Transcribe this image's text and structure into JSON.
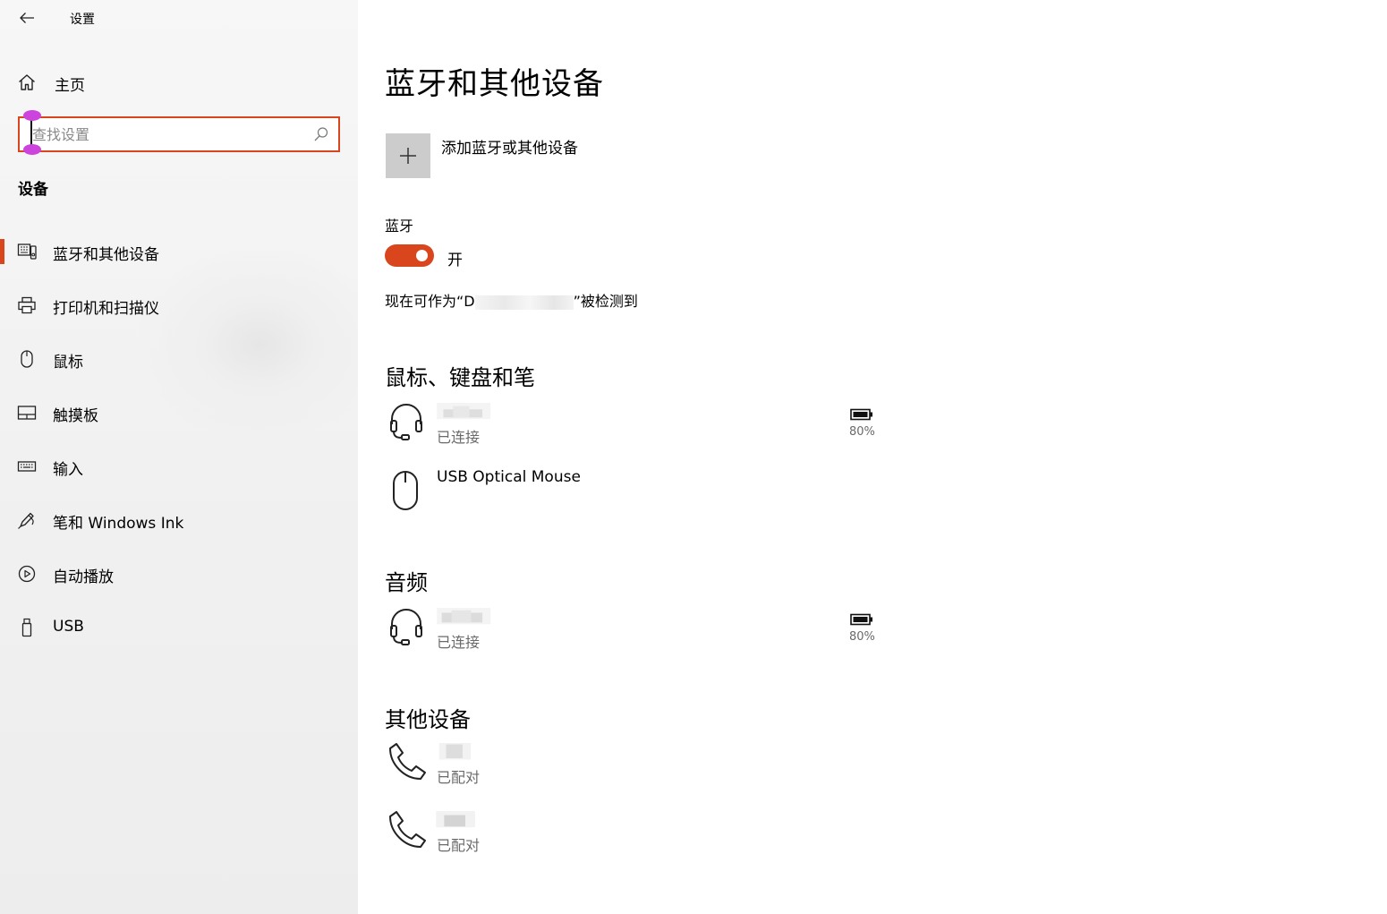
{
  "window": {
    "title": "设置"
  },
  "sidebar": {
    "home_label": "主页",
    "search_placeholder": "查找设置",
    "section_title": "设备",
    "items": [
      {
        "label": "蓝牙和其他设备",
        "icon": "bluetooth-devices-icon",
        "selected": true
      },
      {
        "label": "打印机和扫描仪",
        "icon": "printer-icon",
        "selected": false
      },
      {
        "label": "鼠标",
        "icon": "mouse-icon",
        "selected": false
      },
      {
        "label": "触摸板",
        "icon": "touchpad-icon",
        "selected": false
      },
      {
        "label": "输入",
        "icon": "keyboard-icon",
        "selected": false
      },
      {
        "label": "笔和 Windows Ink",
        "icon": "pen-icon",
        "selected": false
      },
      {
        "label": "自动播放",
        "icon": "autoplay-icon",
        "selected": false
      },
      {
        "label": "USB",
        "icon": "usb-icon",
        "selected": false
      }
    ]
  },
  "main": {
    "title": "蓝牙和其他设备",
    "add_device_label": "添加蓝牙或其他设备",
    "bluetooth": {
      "label": "蓝牙",
      "state_label": "开",
      "on": true,
      "discoverable_prefix": "现在可作为“D",
      "discoverable_suffix": "”被检测到"
    },
    "groups": {
      "input": {
        "title": "鼠标、键盘和笔",
        "devices": [
          {
            "name": "",
            "status": "已连接",
            "icon": "headset-icon",
            "battery": "80%"
          },
          {
            "name": "USB Optical Mouse",
            "status": "",
            "icon": "mouse-icon",
            "battery": ""
          }
        ]
      },
      "audio": {
        "title": "音频",
        "devices": [
          {
            "name": "",
            "status": "已连接",
            "icon": "headset-icon",
            "battery": "80%"
          }
        ]
      },
      "other": {
        "title": "其他设备",
        "devices": [
          {
            "name": "",
            "status": "已配对",
            "icon": "phone-icon"
          },
          {
            "name": "",
            "status": "已配对",
            "icon": "phone-icon"
          }
        ]
      }
    }
  },
  "colors": {
    "accent": "#d9461e",
    "add_tile": "#cccccc",
    "secondary_text": "#6a6a6a"
  }
}
